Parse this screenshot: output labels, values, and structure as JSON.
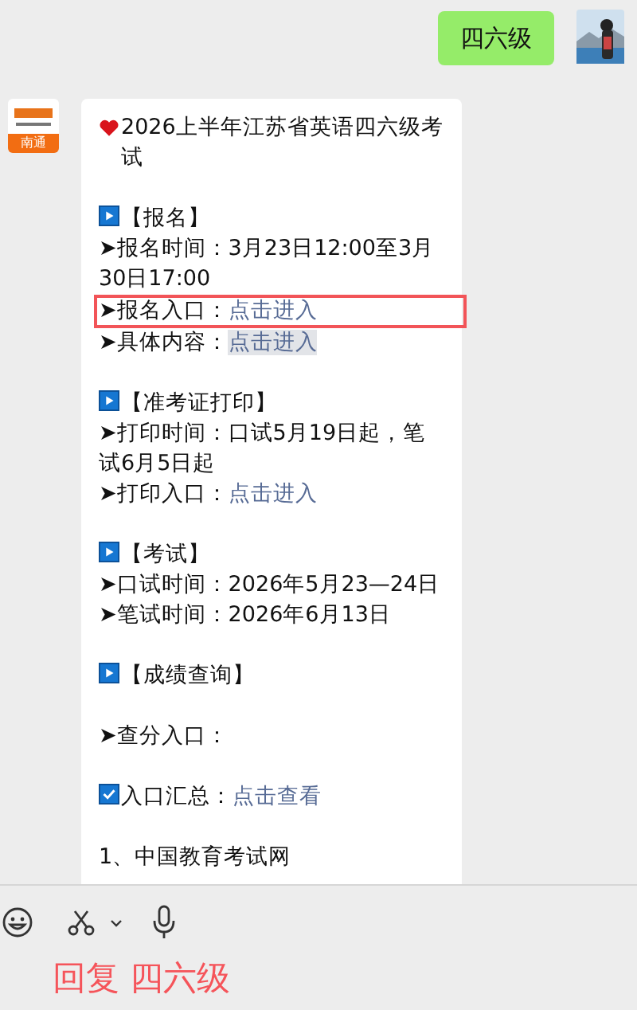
{
  "sent_message": {
    "text": "四六级"
  },
  "received_message": {
    "sender_badge": "南通",
    "lines": [
      {
        "kind": "title",
        "text": "2026上半年江苏省英语四六级考试"
      },
      {
        "kind": "blank"
      },
      {
        "kind": "section",
        "text": "【报名】"
      },
      {
        "kind": "item",
        "text": "➤报名时间：3月23日12:00至3月30日17:00"
      },
      {
        "kind": "item",
        "text": "➤报名入口：",
        "link": "点击进入",
        "highlighted": true,
        "hovered": false
      },
      {
        "kind": "item",
        "text": "➤具体内容：",
        "link": "点击进入",
        "highlighted": false,
        "hovered": true
      },
      {
        "kind": "blank"
      },
      {
        "kind": "section",
        "text": "【准考证打印】"
      },
      {
        "kind": "item",
        "text": "➤打印时间：口试5月19日起，笔试6月5日起"
      },
      {
        "kind": "item",
        "text": "➤打印入口：",
        "link": "点击进入",
        "highlighted": false,
        "hovered": false
      },
      {
        "kind": "blank"
      },
      {
        "kind": "section",
        "text": "【考试】"
      },
      {
        "kind": "item",
        "text": "➤口试时间：2026年5月23—24日"
      },
      {
        "kind": "item",
        "text": "➤笔试时间：2026年6月13日"
      },
      {
        "kind": "blank"
      },
      {
        "kind": "section",
        "text": "【成绩查询】"
      },
      {
        "kind": "blank"
      },
      {
        "kind": "item",
        "text": "➤查分入口："
      },
      {
        "kind": "blank"
      },
      {
        "kind": "check",
        "text": "入口汇总：",
        "link": "点击查看",
        "highlighted": false,
        "hovered": false
      },
      {
        "kind": "blank"
      },
      {
        "kind": "item",
        "text": "1、中国教育考试网"
      }
    ]
  },
  "reply_hint": "回复 四六级"
}
